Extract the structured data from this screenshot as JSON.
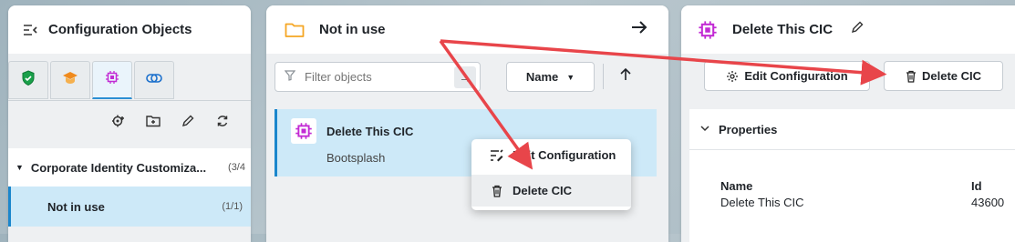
{
  "left_panel": {
    "title": "Configuration Objects",
    "tabs": [
      {
        "icon": "shield-icon",
        "color": "#1aa04a"
      },
      {
        "icon": "graduation-cap-icon",
        "color": "#f08a1c"
      },
      {
        "icon": "chip-icon",
        "color": "#c22bd4",
        "active": true
      },
      {
        "icon": "link-icon",
        "color": "#1a6fcc"
      }
    ],
    "toolbar": [
      "add-config-icon",
      "new-folder-icon",
      "pencil-icon",
      "refresh-icon"
    ],
    "tree": {
      "group_label": "Corporate Identity Customiza...",
      "group_count": "(3/4",
      "selected_label": "Not in use",
      "selected_count": "(1/1)"
    }
  },
  "middle_panel": {
    "title": "Not in use",
    "filter_placeholder": "Filter objects",
    "sort_label": "Name",
    "item": {
      "title": "Delete This CIC",
      "subtitle": "Bootsplash"
    },
    "context_menu": {
      "edit_label": "Edit Configuration",
      "delete_label": "Delete CIC"
    }
  },
  "right_panel": {
    "title": "Delete This CIC",
    "edit_button": "Edit Configuration",
    "delete_button": "Delete CIC",
    "properties_label": "Properties",
    "props": {
      "name_key": "Name",
      "name_value": "Delete This CIC",
      "id_key": "Id",
      "id_value": "43600"
    }
  },
  "colors": {
    "accent": "#1a86cc",
    "selected_bg": "#cde9f8",
    "folder": "#f5a623",
    "chip": "#c22bd4",
    "annotation_arrow": "#e8454a"
  }
}
